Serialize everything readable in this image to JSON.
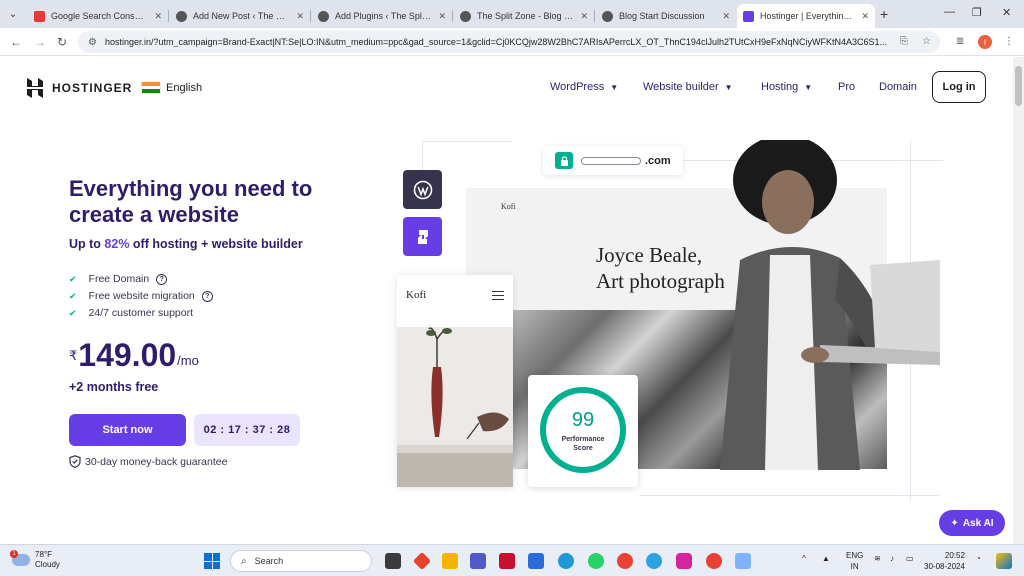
{
  "browser": {
    "tabs": [
      {
        "title": "Google Search Console Se",
        "fav_color": "#e53935"
      },
      {
        "title": "Add New Post ‹ The Split Z",
        "fav_color": "#555555"
      },
      {
        "title": "Add Plugins ‹ The Split Zo",
        "fav_color": "#555555"
      },
      {
        "title": "The Split Zone - Blog Edito",
        "fav_color": "#555555"
      },
      {
        "title": "Blog Start Discussion",
        "fav_color": "#555555"
      },
      {
        "title": "Hostinger | Everything you",
        "fav_color": "#673de6",
        "active": true
      }
    ],
    "url": "hostinger.in/?utm_campaign=Brand-Exact|NT:Se|LO:IN&utm_medium=ppc&gad_source=1&gclid=Cj0KCQjw28W2BhC7ARIsAPerrcLX_OT_ThnC194clJulh2TUtCxH9eFxNqNCiyWFKtN4A3C6S1...",
    "profile_initial": "I"
  },
  "site": {
    "logo_text": "HOSTINGER",
    "language": "English",
    "nav": [
      {
        "label": "WordPress",
        "has_dropdown": true
      },
      {
        "label": "Website builder",
        "has_dropdown": true
      },
      {
        "label": "Hosting",
        "has_dropdown": true
      },
      {
        "label": "Pro",
        "has_dropdown": false
      },
      {
        "label": "Domain",
        "has_dropdown": false
      }
    ],
    "login_label": "Log in"
  },
  "hero": {
    "title": "Everything you need to create a website",
    "sub_prefix": "Up to ",
    "sub_pct": "82%",
    "sub_suffix": " off hosting + website builder",
    "features": [
      {
        "label": "Free Domain",
        "help": true
      },
      {
        "label": "Free website migration",
        "help": true
      },
      {
        "label": "24/7 customer support",
        "help": false
      }
    ],
    "currency": "₹",
    "price": "149.00",
    "period": "/mo",
    "bonus": "+2 months free",
    "cta_label": "Start now",
    "timer": "02 : 17 : 37 : 28",
    "guarantee": "30-day money-back guarantee"
  },
  "visual": {
    "domain_suffix": ".com",
    "preview_brand": "Kofi",
    "preview_headline_1": "Joyce Beale,",
    "preview_headline_2": "Art photograph",
    "mobile_brand": "Kofi",
    "score": "99",
    "score_label_1": "Performance",
    "score_label_2": "Score",
    "score_ratio": 0.99
  },
  "ask_ai_label": "Ask AI",
  "taskbar": {
    "temperature": "78°F",
    "weather": "Cloudy",
    "weather_badge": "1",
    "search_placeholder": "Search",
    "lang_1": "ENG",
    "lang_2": "IN",
    "time": "20:52",
    "date": "30-08-2024"
  }
}
